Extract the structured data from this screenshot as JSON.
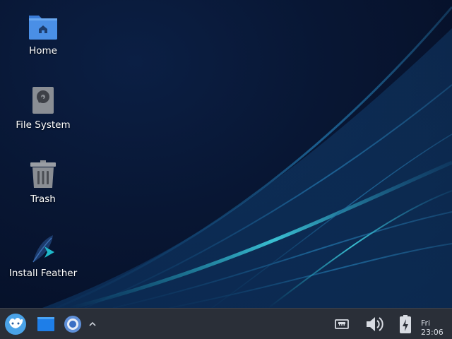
{
  "desktop": {
    "icons": [
      {
        "label": "Home",
        "icon": "home-folder-icon"
      },
      {
        "label": "File System",
        "icon": "drive-icon"
      },
      {
        "label": "Trash",
        "icon": "trash-icon"
      },
      {
        "label": "Install Feather",
        "icon": "feather-installer-icon"
      }
    ]
  },
  "taskbar": {
    "launcher_icon": "zorin-logo-icon",
    "apps": [
      "file-manager-icon",
      "chromium-icon"
    ],
    "overflow_icon": "chevron-up-icon",
    "tray": [
      "network-wired-icon",
      "volume-icon",
      "battery-charging-icon"
    ],
    "clock": "Fri 23:06"
  },
  "colors": {
    "taskbar_bg": "#2a2f38",
    "folder_blue": "#4a8fe6",
    "accent_cyan": "#1fb8c9"
  }
}
